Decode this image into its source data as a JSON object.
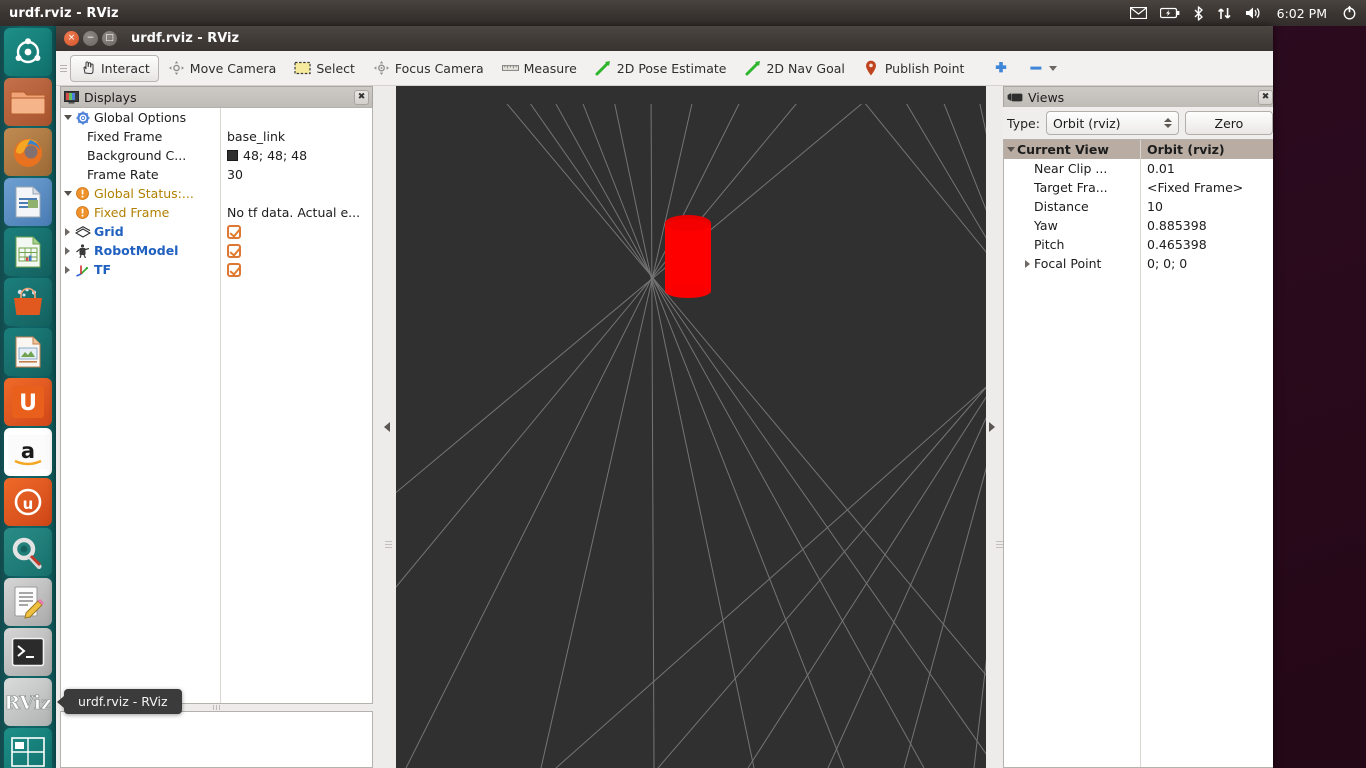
{
  "desktop": {
    "panel_title": "urdf.rviz - RViz",
    "clock": "6:02 PM",
    "indicators": [
      {
        "name": "mail-icon",
        "glyph": "✉"
      },
      {
        "name": "battery-icon",
        "glyph": "▭"
      },
      {
        "name": "bluetooth-icon",
        "glyph": "ᛦ"
      },
      {
        "name": "network-icon",
        "glyph": "⇅"
      },
      {
        "name": "volume-icon",
        "glyph": "◀"
      },
      {
        "name": "power-gear-icon",
        "glyph": "⚙"
      }
    ],
    "launcher_items": [
      {
        "name": "launcher-ubuntu-dash",
        "label": "Dash home"
      },
      {
        "name": "launcher-files",
        "label": "Files"
      },
      {
        "name": "launcher-firefox",
        "label": "Firefox Web Browser"
      },
      {
        "name": "launcher-libreoffice-writer",
        "label": "LibreOffice Writer"
      },
      {
        "name": "launcher-libreoffice-calc",
        "label": "LibreOffice Calc"
      },
      {
        "name": "launcher-ubuntu-software",
        "label": "Ubuntu Software Center"
      },
      {
        "name": "launcher-libreoffice-impress",
        "label": "LibreOffice Impress"
      },
      {
        "name": "launcher-ubuntu-one",
        "label": "Ubuntu One"
      },
      {
        "name": "launcher-amazon",
        "label": "Amazon"
      },
      {
        "name": "launcher-ubuntu-one-music",
        "label": "Ubuntu One Music"
      },
      {
        "name": "launcher-system-settings",
        "label": "System Settings"
      },
      {
        "name": "launcher-text-editor",
        "label": "Text Editor"
      },
      {
        "name": "launcher-terminal",
        "label": "Terminal"
      },
      {
        "name": "launcher-rviz",
        "label": "RViz"
      },
      {
        "name": "launcher-workspace-switcher",
        "label": "Workspace Switcher"
      }
    ]
  },
  "window": {
    "title": "urdf.rviz - RViz",
    "buttons": {
      "close": "×",
      "minimize": "−",
      "maximize": "□"
    }
  },
  "toolbar": {
    "items": [
      {
        "label": "Interact",
        "icon": "hand-cursor-icon",
        "active": true
      },
      {
        "label": "Move Camera",
        "icon": "move-camera-icon",
        "active": false
      },
      {
        "label": "Select",
        "icon": "select-rect-icon",
        "active": false
      },
      {
        "label": "Focus Camera",
        "icon": "focus-camera-icon",
        "active": false
      },
      {
        "label": "Measure",
        "icon": "ruler-icon",
        "active": false
      },
      {
        "label": "2D Pose Estimate",
        "icon": "pose-arrow-icon",
        "active": false
      },
      {
        "label": "2D Nav Goal",
        "icon": "nav-goal-arrow-icon",
        "active": false
      },
      {
        "label": "Publish Point",
        "icon": "map-pin-icon",
        "active": false
      }
    ],
    "add_tool_icon": "plus-icon",
    "remove_tool_icon": "minus-icon",
    "overflow_icon": "chevron-down-icon"
  },
  "displays": {
    "title": "Displays",
    "header_icon": "displays-monitor-icon",
    "close_icon": "close-icon",
    "rows": [
      {
        "name": "global-options",
        "label": "Global Options",
        "value": "",
        "indent": 0,
        "twisty": "open",
        "icon": "gear-icon",
        "style": "plain"
      },
      {
        "name": "fixed-frame",
        "label": "Fixed Frame",
        "value": "base_link",
        "indent": 1,
        "twisty": "none",
        "icon": "none",
        "style": "plain"
      },
      {
        "name": "background-color",
        "label": "Background C...",
        "value": "48; 48; 48",
        "indent": 1,
        "twisty": "none",
        "icon": "none",
        "style": "plain",
        "swatch": "#303030"
      },
      {
        "name": "frame-rate",
        "label": "Frame Rate",
        "value": "30",
        "indent": 1,
        "twisty": "none",
        "icon": "none",
        "style": "plain"
      },
      {
        "name": "global-status",
        "label": "Global Status:...",
        "value": "",
        "indent": 0,
        "twisty": "open",
        "icon": "warning-icon",
        "style": "warn"
      },
      {
        "name": "global-status-fixed-frame",
        "label": "Fixed Frame",
        "value": "No tf data.  Actual e...",
        "indent": 1,
        "twisty": "none",
        "icon": "warning-icon",
        "style": "warn"
      },
      {
        "name": "display-grid",
        "label": "Grid",
        "value": "",
        "indent": 0,
        "twisty": "closed",
        "icon": "grid-icon",
        "style": "link",
        "checkbox": true
      },
      {
        "name": "display-robotmodel",
        "label": "RobotModel",
        "value": "",
        "indent": 0,
        "twisty": "closed",
        "icon": "robot-icon",
        "style": "link",
        "checkbox": true
      },
      {
        "name": "display-tf",
        "label": "TF",
        "value": "",
        "indent": 0,
        "twisty": "closed",
        "icon": "tf-axes-icon",
        "style": "link",
        "checkbox": true
      }
    ]
  },
  "views": {
    "title": "Views",
    "header_icon": "views-camera-icon",
    "close_icon": "close-icon",
    "type_label": "Type:",
    "type_value": "Orbit (rviz)",
    "zero_button": "Zero",
    "header_row": {
      "label": "Current View",
      "value": "Orbit (rviz)"
    },
    "rows": [
      {
        "name": "near-clip-distance",
        "label": "Near Clip ...",
        "value": "0.01",
        "twisty": "none"
      },
      {
        "name": "target-frame",
        "label": "Target Fra...",
        "value": "<Fixed Frame>",
        "twisty": "none"
      },
      {
        "name": "distance",
        "label": "Distance",
        "value": "10",
        "twisty": "none"
      },
      {
        "name": "yaw",
        "label": "Yaw",
        "value": "0.885398",
        "twisty": "none"
      },
      {
        "name": "pitch",
        "label": "Pitch",
        "value": "0.465398",
        "twisty": "none"
      },
      {
        "name": "focal-point",
        "label": "Focal Point",
        "value": "0; 0; 0",
        "twisty": "closed"
      }
    ]
  },
  "viewport": {
    "background_color": "#303030",
    "grid_color": "#a0a0a0",
    "object_color": "#ff0000",
    "object_name": "red-cylinder"
  },
  "tooltip": {
    "text": "urdf.rviz - RViz"
  }
}
